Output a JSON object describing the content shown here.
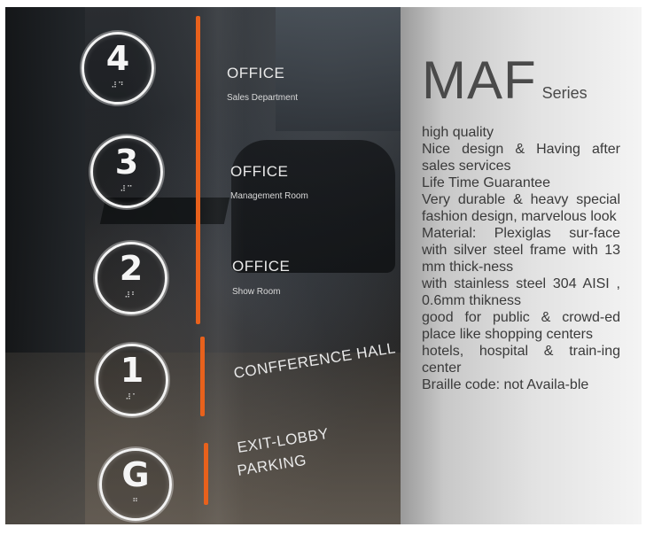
{
  "sign": {
    "floors": [
      {
        "number": "4",
        "braille": "⠼⠙",
        "title": "OFFICE",
        "subtitle": "Sales Department"
      },
      {
        "number": "3",
        "braille": "⠼⠉",
        "title": "OFFICE",
        "subtitle": "Management Room"
      },
      {
        "number": "2",
        "braille": "⠼⠃",
        "title": "OFFICE",
        "subtitle": "Show Room"
      },
      {
        "number": "1",
        "braille": "⠼⠁",
        "title": "CONFFERENCE HALL"
      },
      {
        "number": "G",
        "braille": "⠛",
        "title": "EXIT-LOBBY",
        "title2": "PARKING"
      }
    ],
    "accent_color": "#e8611c"
  },
  "panel": {
    "brand": "MAF",
    "series": "Series",
    "features": [
      "high quality",
      "Nice design & Having after sales services",
      "Life Time Guarantee",
      "Very durable & heavy special fashion design, marvelous look",
      "Material: Plexiglas sur-face with silver steel frame with 13 mm thick-ness",
      "with stainless steel 304 AISI , 0.6mm thikness",
      "good for public & crowd-ed place like shopping centers",
      "hotels, hospital & train-ing center",
      "Braille code: not Availa-ble"
    ]
  }
}
